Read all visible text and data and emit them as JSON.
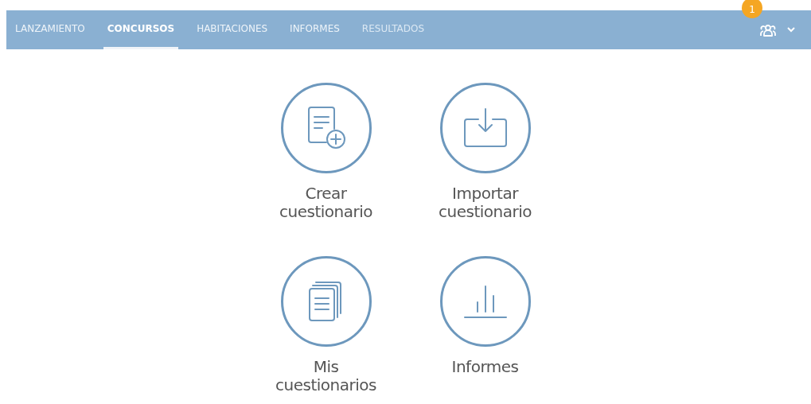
{
  "tabs": [
    {
      "label": "LANZAMIENTO",
      "selected": false,
      "disabled": false
    },
    {
      "label": "CONCURSOS",
      "selected": true,
      "disabled": false
    },
    {
      "label": "HABITACIONES",
      "selected": false,
      "disabled": false
    },
    {
      "label": "INFORMES",
      "selected": false,
      "disabled": false
    },
    {
      "label": "RESULTADOS",
      "selected": false,
      "disabled": true
    }
  ],
  "account": {
    "badge": "1"
  },
  "tiles": [
    {
      "kind": "create",
      "label": "Crear cuestionario"
    },
    {
      "kind": "import",
      "label": "Importar cuestionario"
    },
    {
      "kind": "list",
      "label": "Mis cuestionarios"
    },
    {
      "kind": "reports",
      "label": "Informes"
    }
  ]
}
